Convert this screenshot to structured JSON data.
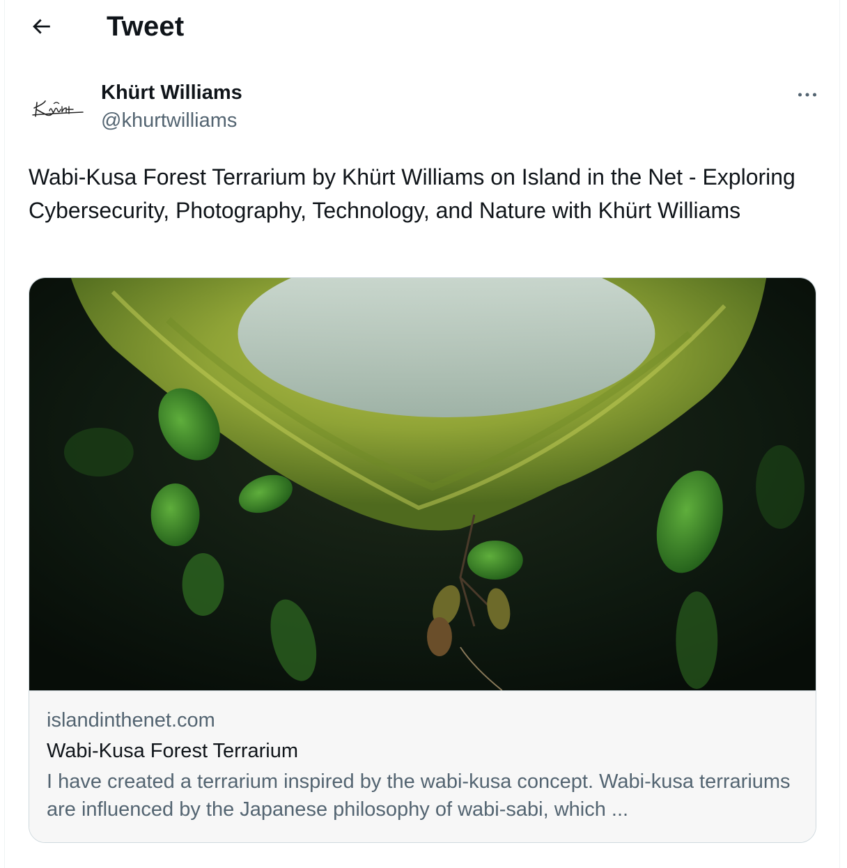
{
  "header": {
    "back_icon": "arrow-left-icon",
    "title": "Tweet"
  },
  "author": {
    "avatar_text": "Khürt",
    "name": "Khürt Williams",
    "handle": "@khurtwilliams",
    "more_icon": "more-horizontal-icon"
  },
  "tweet": {
    "text": "Wabi-Kusa Forest Terrarium by Khürt Williams on Island in the Net - Exploring Cybersecurity, Photography, Technology, and Nature with Khürt Williams"
  },
  "card": {
    "image_subject": "moss-terrarium-photo",
    "domain": "islandinthenet.com",
    "title": "Wabi-Kusa Forest Terrarium",
    "description": "I have created a terrarium inspired by the wabi-kusa concept. Wabi-kusa terrariums are influenced by the Japanese philosophy of wabi-sabi, which ..."
  },
  "colors": {
    "text_primary": "#0f1419",
    "text_secondary": "#536471",
    "border": "#cfd9de",
    "card_meta_bg": "#f7f7f7"
  }
}
